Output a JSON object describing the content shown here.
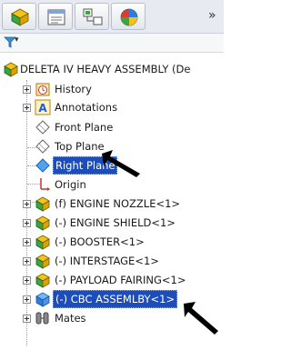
{
  "tabs": [
    {
      "name": "feature-manager-tab"
    },
    {
      "name": "property-manager-tab"
    },
    {
      "name": "configuration-manager-tab"
    },
    {
      "name": "appearance-tab"
    }
  ],
  "tab_more_label": "»",
  "filter": {
    "icon": "filter-icon",
    "dropdown": "▾"
  },
  "root": {
    "label": "DELETA IV HEAVY ASSEMBLY  (De"
  },
  "items": [
    {
      "label": "History",
      "icon": "history-icon",
      "expandable": true
    },
    {
      "label": "Annotations",
      "icon": "annotations-icon",
      "expandable": true
    },
    {
      "label": "Front Plane",
      "icon": "plane-icon",
      "expandable": false
    },
    {
      "label": "Top Plane",
      "icon": "plane-icon",
      "expandable": false
    },
    {
      "label": "Right Plane",
      "icon": "plane-icon",
      "expandable": false,
      "selected": true
    },
    {
      "label": "Origin",
      "icon": "origin-icon",
      "expandable": false
    },
    {
      "label": "(f) ENGINE NOZZLE<1>",
      "icon": "part-icon",
      "expandable": true
    },
    {
      "label": "(-) ENGINE SHIELD<1>",
      "icon": "part-icon",
      "expandable": true
    },
    {
      "label": "(-) BOOSTER<1>",
      "icon": "part-icon",
      "expandable": true
    },
    {
      "label": "(-) INTERSTAGE<1>",
      "icon": "part-icon",
      "expandable": true
    },
    {
      "label": "(-) PAYLOAD FAIRING<1>",
      "icon": "part-icon",
      "expandable": true
    },
    {
      "label": "(-) CBC ASSEMLBY<1>",
      "icon": "part-icon",
      "expandable": true,
      "selected": true
    },
    {
      "label": "Mates",
      "icon": "mates-icon",
      "expandable": true
    }
  ],
  "colors": {
    "selection": "#1d4db8",
    "part_yellow": "#f2c418",
    "part_green": "#3aa640",
    "annotation_blue": "#1e5bd6"
  }
}
